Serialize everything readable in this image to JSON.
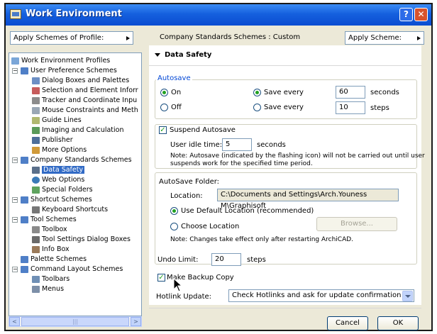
{
  "window": {
    "title": "Work Environment",
    "help_label": "?",
    "close_label": "✕"
  },
  "toolbar": {
    "apply_profile_label": "Apply Schemes of Profile:",
    "scheme_text": "Company Standards Schemes : Custom",
    "apply_scheme_label": "Apply Scheme:"
  },
  "tree": {
    "root": "Work Environment Profiles",
    "items": [
      {
        "label": "User Preference Schemes",
        "icon": "folder-icon"
      },
      {
        "label": "Dialog Boxes and Palettes",
        "icon": "dialog-icon"
      },
      {
        "label": "Selection and Element Inforr",
        "icon": "selection-icon"
      },
      {
        "label": "Tracker and Coordinate Inpu",
        "icon": "tracker-icon"
      },
      {
        "label": "Mouse Constraints and Meth",
        "icon": "mouse-icon"
      },
      {
        "label": "Guide Lines",
        "icon": "guide-lines-icon"
      },
      {
        "label": "Imaging and Calculation",
        "icon": "imaging-icon"
      },
      {
        "label": "Publisher",
        "icon": "publisher-icon"
      },
      {
        "label": "More Options",
        "icon": "more-options-icon"
      },
      {
        "label": "Company Standards Schemes",
        "icon": "folder-icon"
      },
      {
        "label": "Data Safety",
        "icon": "data-safety-icon"
      },
      {
        "label": "Web Options",
        "icon": "globe-icon"
      },
      {
        "label": "Special Folders",
        "icon": "special-folders-icon"
      },
      {
        "label": "Shortcut Schemes",
        "icon": "folder-icon"
      },
      {
        "label": "Keyboard Shortcuts",
        "icon": "keyboard-icon"
      },
      {
        "label": "Tool Schemes",
        "icon": "folder-icon"
      },
      {
        "label": "Toolbox",
        "icon": "toolbox-icon"
      },
      {
        "label": "Tool Settings Dialog Boxes",
        "icon": "tool-settings-icon"
      },
      {
        "label": "Info Box",
        "icon": "info-box-icon"
      },
      {
        "label": "Palette Schemes",
        "icon": "folder-icon"
      },
      {
        "label": "Command Layout Schemes",
        "icon": "folder-icon"
      },
      {
        "label": "Toolbars",
        "icon": "toolbars-icon"
      },
      {
        "label": "Menus",
        "icon": "menus-icon"
      }
    ],
    "scroll_left": "<",
    "scroll_right": ">",
    "scroll_thumb": "|||"
  },
  "panel": {
    "section_title": "Data Safety",
    "autosave": {
      "title": "Autosave",
      "on_label": "On",
      "off_label": "Off",
      "save_every_label": "Save every",
      "seconds_value": "60",
      "seconds_unit": "seconds",
      "steps_value": "10",
      "steps_unit": "steps"
    },
    "suspend": {
      "label": "Suspend Autosave",
      "idle_label": "User idle time:",
      "idle_value": "5",
      "idle_unit": "seconds",
      "note_line1": "Note: Autosave (indicated by the flashing icon) will not be carried out until user",
      "note_line2": "suspends work for the specified time period."
    },
    "folder": {
      "title": "AutoSave Folder:",
      "location_label": "Location:",
      "location_value": "C:\\Documents and Settings\\Arch.Youness M\\Graphisoft",
      "default_label": "Use Default Location (recommended)",
      "choose_label": "Choose Location",
      "browse_label": "Browse...",
      "note": "Note: Changes take effect only after restarting ArchiCAD."
    },
    "undo": {
      "label": "Undo Limit:",
      "value": "20",
      "unit": "steps"
    },
    "backup": {
      "label": "Make Backup Copy"
    },
    "hotlink": {
      "label": "Hotlink Update:",
      "value": "Check Hotlinks and ask for update confirmation"
    }
  },
  "buttons": {
    "cancel": "Cancel",
    "ok": "OK"
  },
  "colors": {
    "accent": "#316ac5",
    "title_blue": "#0a4cd1",
    "group_title": "#0046d5",
    "radio_dot": "#21a121"
  }
}
